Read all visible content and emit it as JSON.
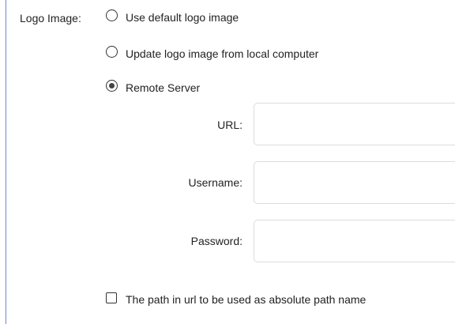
{
  "logo_image": {
    "label": "Logo Image:",
    "options": [
      {
        "label": "Use default logo image",
        "selected": false
      },
      {
        "label": "Update logo image from local computer",
        "selected": false
      },
      {
        "label": "Remote Server",
        "selected": true
      }
    ]
  },
  "remote_server": {
    "url": {
      "label": "URL:",
      "value": ""
    },
    "username": {
      "label": "Username:",
      "value": ""
    },
    "password": {
      "label": "Password:",
      "value": ""
    }
  },
  "absolute_path": {
    "label": "The path in url to be used as absolute path name",
    "checked": false
  }
}
